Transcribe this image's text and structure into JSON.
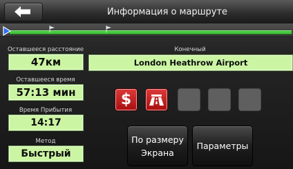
{
  "header": {
    "title": "Информация о маршруте"
  },
  "info": {
    "remaining_distance": {
      "label": "Оставшееся расстояние",
      "value": "47км"
    },
    "remaining_time": {
      "label": "Оставшееся время",
      "value": "57:13 мин"
    },
    "arrival_time": {
      "label": "Время Прибытия",
      "value": "14:17"
    },
    "method": {
      "label": "Метод",
      "value": "Быстрый"
    }
  },
  "destination": {
    "label": "Конечный",
    "value": "London Heathrow Airport"
  },
  "route_types": [
    {
      "icon": "dollar-icon",
      "active": true
    },
    {
      "icon": "highway-icon",
      "active": true
    },
    {
      "icon": "empty-slot",
      "active": false
    },
    {
      "icon": "empty-slot",
      "active": false
    },
    {
      "icon": "empty-slot",
      "active": false
    }
  ],
  "buttons": {
    "fit_to_screen": "По размеру\nЭкрана",
    "parameters": "Параметры"
  },
  "colors": {
    "value_box_bg": "#cbf5a3",
    "route_line": "#46c640",
    "active_icon": "#c41f1f"
  }
}
